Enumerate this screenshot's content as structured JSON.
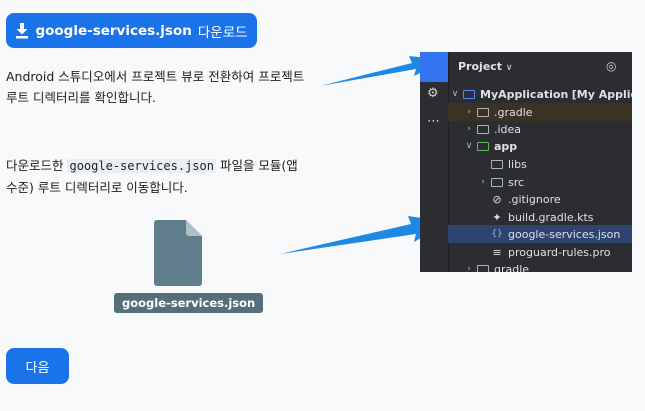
{
  "download_button": {
    "filename": "google-services.json",
    "action": "다운로드",
    "icon": "download-icon"
  },
  "instruction1": {
    "text": "Android 스튜디오에서 프로젝트 뷰로 전환하여 프로젝트 루트 디렉터리를 확인합니다."
  },
  "instruction2": {
    "before": "다운로드한 ",
    "code": "google-services.json",
    "after": " 파일을 모듈(앱 수준) 루트 디렉터리로 이동합니다."
  },
  "file_label": "google-services.json",
  "ide": {
    "header": "Project",
    "tree": [
      {
        "label": "MyApplication",
        "suffix": "[My Application]"
      },
      {
        "label": ".gradle"
      },
      {
        "label": ".idea"
      },
      {
        "label": "app"
      },
      {
        "label": "libs"
      },
      {
        "label": "src"
      },
      {
        "label": ".gitignore"
      },
      {
        "label": "build.gradle.kts"
      },
      {
        "label": "google-services.json"
      },
      {
        "label": "proguard-rules.pro"
      },
      {
        "label": "gradle"
      }
    ]
  },
  "next_button": {
    "label": "다음"
  },
  "colors": {
    "primary": "#1a73e8",
    "arrow": "#1e88e5",
    "ide_bg": "#2b2d30",
    "ide_selected": "#2e436e",
    "file_label_bg": "#546e7a"
  }
}
